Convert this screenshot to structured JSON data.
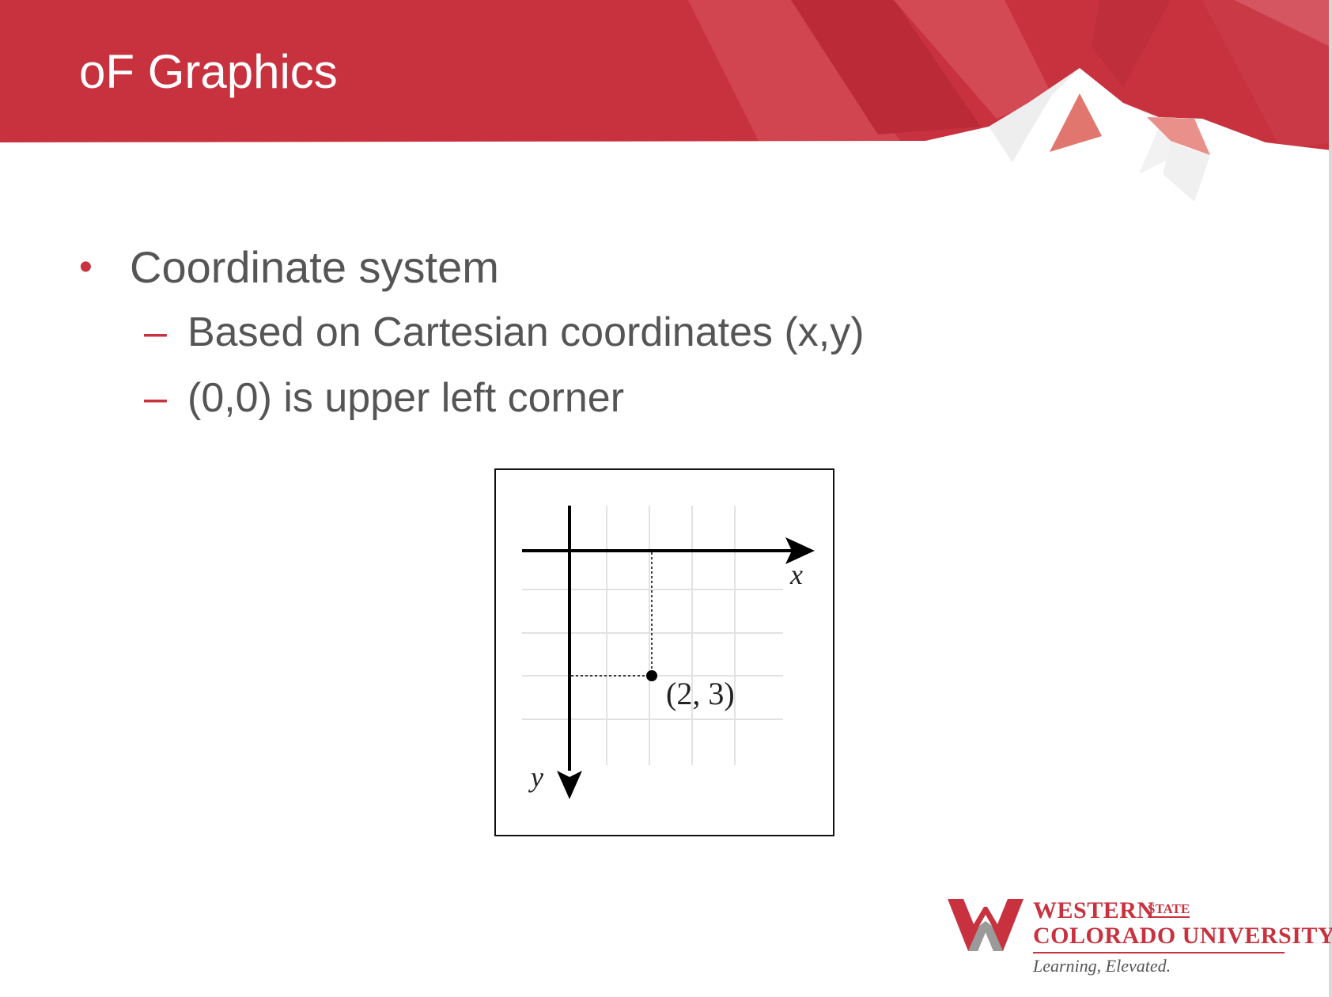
{
  "slide": {
    "title": "oF Graphics",
    "bullets": [
      {
        "text": "Coordinate system",
        "marker": "•",
        "children": [
          {
            "text": "Based on Cartesian coordinates (x,y)",
            "marker": "–"
          },
          {
            "text": "(0,0) is upper left corner",
            "marker": "–"
          }
        ]
      }
    ]
  },
  "figure": {
    "x_axis_label": "x",
    "y_axis_label": "y",
    "point_label": "(2, 3)",
    "point": {
      "x": 2,
      "y": 3
    }
  },
  "logo": {
    "line1": "WESTERN",
    "state": "STATE",
    "line2": "COLORADO UNIVERSITY",
    "tagline": "Learning, Elevated."
  },
  "colors": {
    "header_red": "#c8323f",
    "bullet_red": "#c8323f",
    "body_text": "#555555"
  }
}
